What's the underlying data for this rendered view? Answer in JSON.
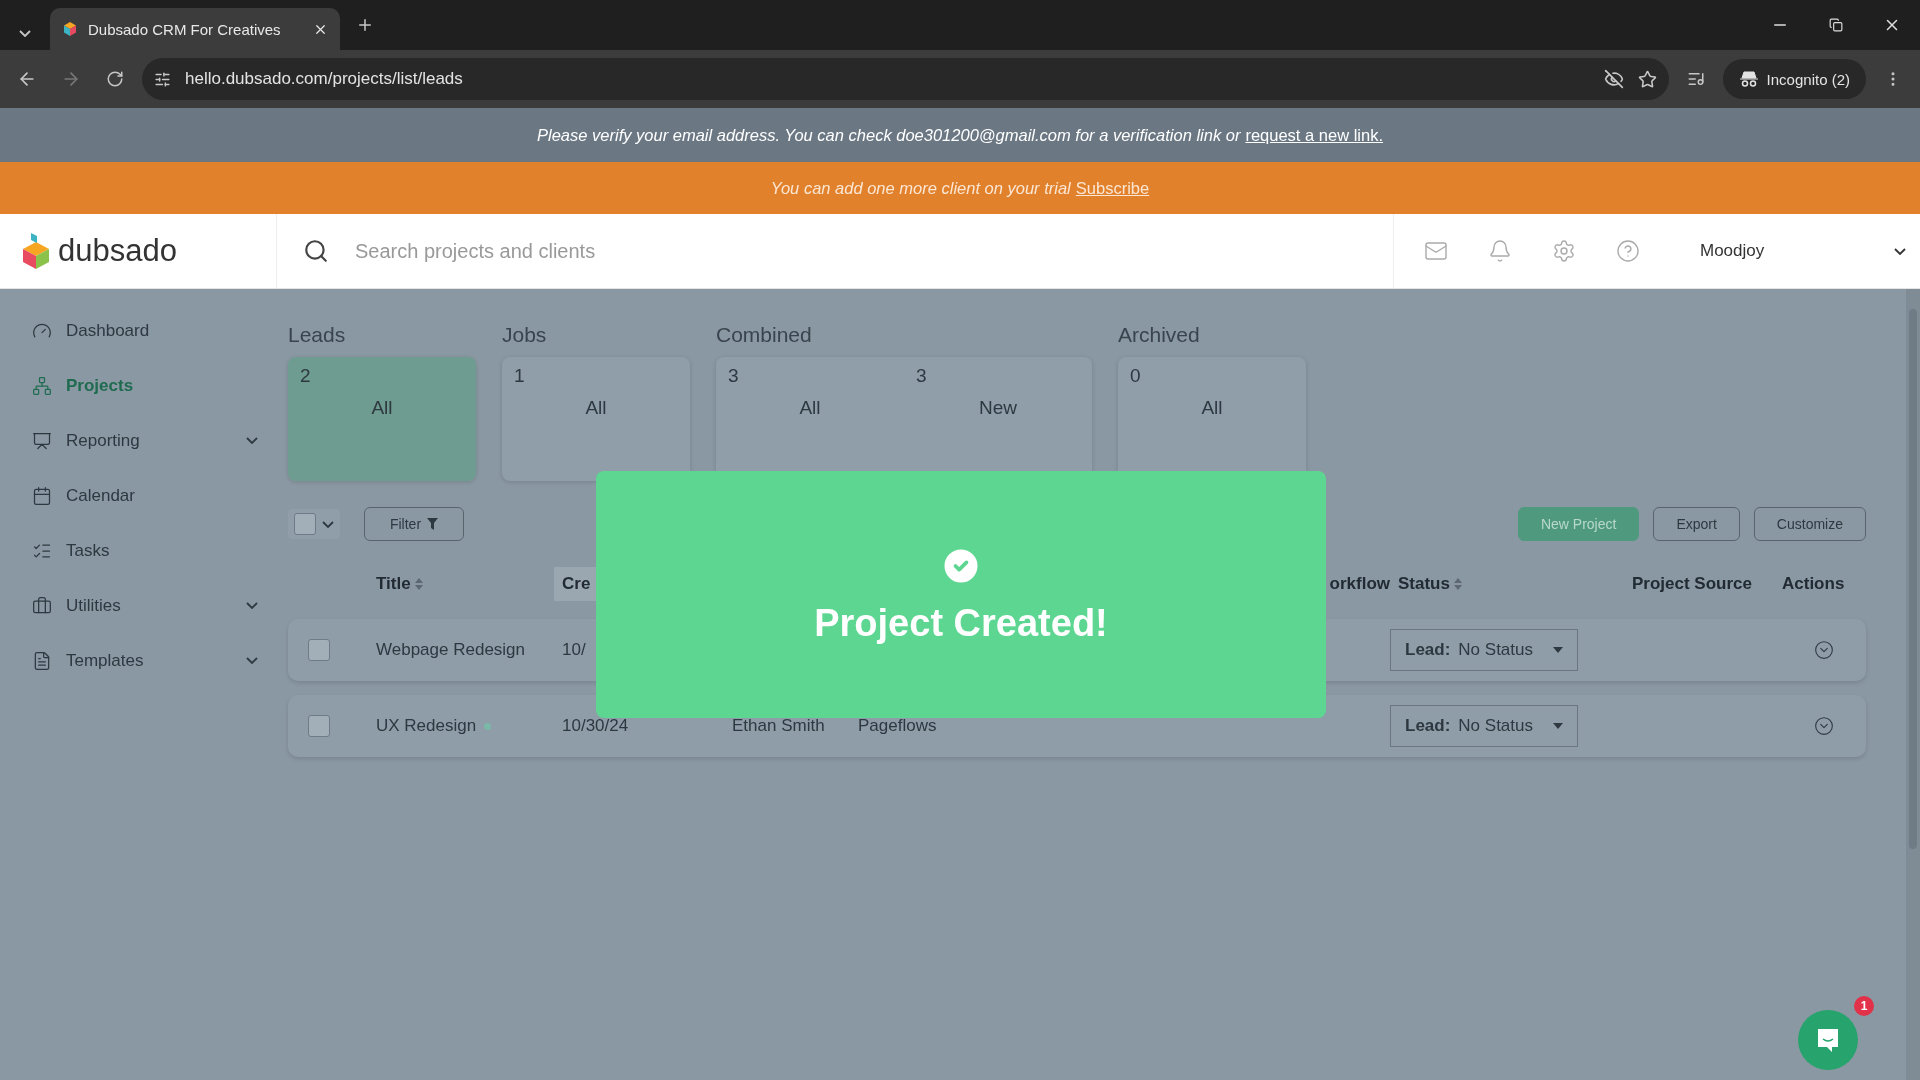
{
  "browser": {
    "tabs": [
      {
        "title": "Dubsado CRM For Creatives",
        "selected": true
      }
    ],
    "url": "hello.dubsado.com/projects/list/leads",
    "profile": "Incognito (2)"
  },
  "banners": [
    {
      "kind": "verify",
      "text": "Please verify your email address. You can check doe301200@gmail.com for a verification link or",
      "link": "request a new link."
    },
    {
      "kind": "trial",
      "text": "You can add one more client on your trial",
      "link": "Subscribe"
    }
  ],
  "header": {
    "logo": "dubsado",
    "search": {
      "placeholder": "Search projects and clients"
    },
    "user": "Moodjoy"
  },
  "sidebar": {
    "items": [
      {
        "label": "Dashboard",
        "selected": false,
        "expandable": false
      },
      {
        "label": "Projects",
        "selected": true,
        "expandable": false
      },
      {
        "label": "Reporting",
        "selected": false,
        "expandable": true
      },
      {
        "label": "Calendar",
        "selected": false,
        "expandable": false
      },
      {
        "label": "Tasks",
        "selected": false,
        "expandable": false
      },
      {
        "label": "Utilities",
        "selected": false,
        "expandable": true
      },
      {
        "label": "Templates",
        "selected": false,
        "expandable": true
      }
    ]
  },
  "stats": [
    {
      "label": "Leads",
      "cards": [
        {
          "count": "2",
          "label": "All",
          "selected": true
        }
      ]
    },
    {
      "label": "Jobs",
      "cards": [
        {
          "count": "1",
          "label": "All",
          "selected": false
        }
      ]
    },
    {
      "label": "Combined",
      "cards": [
        {
          "count": "3",
          "label": "All",
          "selected": false
        },
        {
          "count": "3",
          "label": "New",
          "selected": false
        }
      ]
    },
    {
      "label": "Archived",
      "cards": [
        {
          "count": "0",
          "label": "All",
          "selected": false
        }
      ]
    }
  ],
  "toolbar": {
    "filter": "Filter",
    "buttons": [
      {
        "label": "New Project",
        "kind": "primary"
      },
      {
        "label": "Export",
        "kind": "outline"
      },
      {
        "label": "Customize",
        "kind": "outline"
      }
    ]
  },
  "table": {
    "columns": [
      {
        "label": "Title",
        "sortable": true,
        "sorted": false
      },
      {
        "label": "Cre",
        "sortable": false,
        "sorted": true
      },
      {
        "label": "orkflow",
        "sortable": false,
        "sorted": false
      },
      {
        "label": "Status",
        "sortable": true,
        "sorted": false
      },
      {
        "label": "Project Source",
        "sortable": false,
        "sorted": false
      },
      {
        "label": "Actions",
        "sortable": false,
        "sorted": false
      }
    ],
    "rows": [
      {
        "checked": false,
        "title": "Webpage Redesign",
        "new_dot": false,
        "created": "10/",
        "client": "",
        "workflow": "",
        "status_label": "Lead:",
        "status": "No Status"
      },
      {
        "checked": false,
        "title": "UX Redesign",
        "new_dot": true,
        "created": "10/30/24",
        "client": "Ethan Smith",
        "workflow": "Pageflows",
        "status_label": "Lead:",
        "status": "No Status"
      }
    ]
  },
  "toast": {
    "title": "Project Created!"
  },
  "chat": {
    "badge": "1"
  }
}
